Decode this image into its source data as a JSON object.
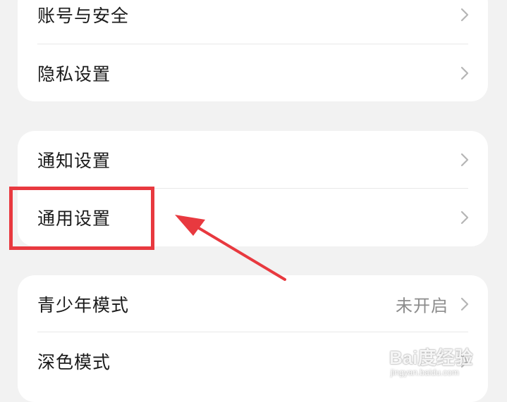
{
  "colors": {
    "background": "#f2f2f2",
    "card": "#ffffff",
    "text": "#1a1a1a",
    "secondary": "#8c8c8c",
    "chevron": "#b5b5b5",
    "annotation": "#e8393f"
  },
  "groups": [
    {
      "items": [
        {
          "label": "账号与安全",
          "value": "",
          "icon": "chevron-right-icon"
        },
        {
          "label": "隐私设置",
          "value": "",
          "icon": "chevron-right-icon"
        }
      ]
    },
    {
      "items": [
        {
          "label": "通知设置",
          "value": "",
          "icon": "chevron-right-icon"
        },
        {
          "label": "通用设置",
          "value": "",
          "icon": "chevron-right-icon"
        }
      ]
    },
    {
      "items": [
        {
          "label": "青少年模式",
          "value": "未开启",
          "icon": "chevron-right-icon"
        },
        {
          "label": "深色模式",
          "value": "",
          "icon": "chevron-right-icon"
        }
      ]
    }
  ],
  "annotation": {
    "highlighted_item": "通用设置",
    "shape": "rectangle-with-arrow"
  },
  "watermark": {
    "logo": "Bai度经验",
    "url": "jingyan.baidu.com"
  }
}
